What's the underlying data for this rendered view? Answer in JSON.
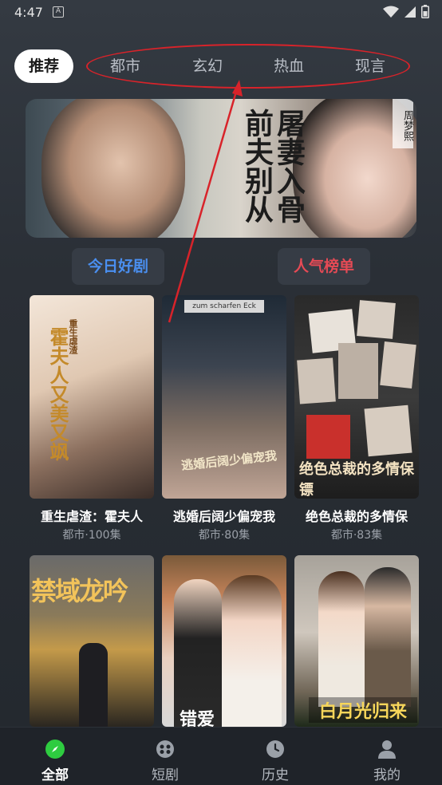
{
  "status_bar": {
    "time": "4:47",
    "notification_glyph": "A"
  },
  "tabs": {
    "active": "推荐",
    "items": [
      "都市",
      "玄幻",
      "热血",
      "现言"
    ]
  },
  "banner": {
    "title": "屠妻入骨 前夫别从",
    "seal_text": "周梦熙"
  },
  "sections": {
    "today": "今日好剧",
    "popular": "人气榜单"
  },
  "cards": [
    {
      "title": "重生虐渣：霍夫人",
      "meta": "都市·100集",
      "poster_text": "霍夫人又美又飒",
      "poster_tag": "重生虐渣"
    },
    {
      "title": "逃婚后阔少偏宠我",
      "meta": "都市·80集",
      "poster_text": "逃婚后阔少偏宠我",
      "sign_text": "zum scharfen Eck"
    },
    {
      "title": "绝色总裁的多情保",
      "meta": "都市·83集",
      "poster_text": "绝色总裁的多情保镖"
    },
    {
      "title": "",
      "meta": "",
      "poster_text": "禁域龙吟"
    },
    {
      "title": "",
      "meta": "",
      "poster_text": "错爱"
    },
    {
      "title": "",
      "meta": "",
      "poster_text": "白月光归来"
    }
  ],
  "bottom_nav": [
    {
      "label": "全部",
      "icon": "compass-icon",
      "active": true
    },
    {
      "label": "短剧",
      "icon": "film-reel-icon",
      "active": false
    },
    {
      "label": "历史",
      "icon": "clock-icon",
      "active": false
    },
    {
      "label": "我的",
      "icon": "person-icon",
      "active": false
    }
  ],
  "colors": {
    "accent_green": "#2ecc40",
    "today_blue": "#4a8ff0",
    "popular_red": "#e54a55",
    "annotation_red": "#d8232a"
  }
}
